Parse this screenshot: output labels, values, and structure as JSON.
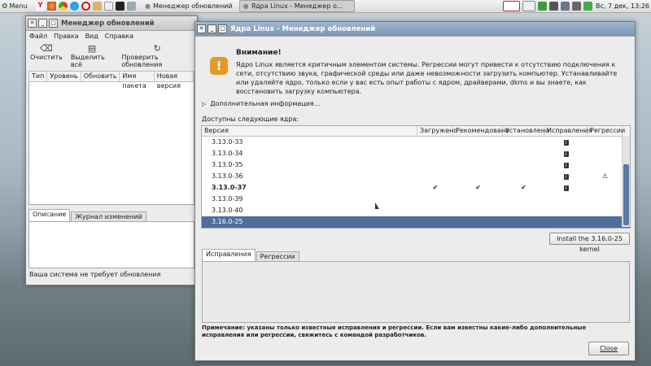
{
  "panel": {
    "menu_label": "Menu",
    "taskbar": [
      {
        "label": "Менеджер обновлений",
        "active": false
      },
      {
        "label": "Ядра Linux - Менеджер о...",
        "active": true
      }
    ],
    "clock": "Вс, 7 дек, 13:26"
  },
  "update_manager": {
    "title": "Менеджер обновлений",
    "menu": [
      "Файл",
      "Правка",
      "Вид",
      "Справка"
    ],
    "toolbar": [
      "Очистить",
      "Выделить всё",
      "Проверить обновления"
    ],
    "columns": [
      "Тип",
      "Уровень",
      "Обновить",
      "Имя пакета",
      "Новая версия"
    ],
    "tabs": [
      "Описание",
      "Журнал изменений"
    ],
    "status": "Ваша система не требует обновления"
  },
  "kernels": {
    "title": "Ядра Linux - Менеджер обновлений",
    "warning_heading": "Внимание!",
    "warning_text": "Ядро Linux является критичным элементом системы. Регрессии могут привести к отсутствию подключения к сети, отсутствию звука, графической среды или даже невозможности загрузить компьютер. Устанавливайте или удаляйте ядро, только если у вас есть опыт работы с ядром, драйверами, dkms и вы знаете, как восстановить загрузку компьютера.",
    "more_info": "Дополнительная информация...",
    "available_label": "Доступны следующие ядра:",
    "columns": [
      "Версия",
      "Загружено",
      "Рекомендовано",
      "Установлено",
      "Исправления",
      "Регрессии"
    ],
    "rows": [
      {
        "version": "3.13.0-33",
        "loaded": "",
        "recommended": "",
        "installed": "",
        "fixes": true,
        "regress": false,
        "bold": false,
        "selected": false
      },
      {
        "version": "3.13.0-34",
        "loaded": "",
        "recommended": "",
        "installed": "",
        "fixes": true,
        "regress": false,
        "bold": false,
        "selected": false
      },
      {
        "version": "3.13.0-35",
        "loaded": "",
        "recommended": "",
        "installed": "",
        "fixes": true,
        "regress": false,
        "bold": false,
        "selected": false
      },
      {
        "version": "3.13.0-36",
        "loaded": "",
        "recommended": "",
        "installed": "",
        "fixes": true,
        "regress": true,
        "bold": false,
        "selected": false
      },
      {
        "version": "3.13.0-37",
        "loaded": "✔",
        "recommended": "✔",
        "installed": "✔",
        "fixes": true,
        "regress": false,
        "bold": true,
        "selected": false
      },
      {
        "version": "3.13.0-39",
        "loaded": "",
        "recommended": "",
        "installed": "",
        "fixes": false,
        "regress": false,
        "bold": false,
        "selected": false
      },
      {
        "version": "3.13.0-40",
        "loaded": "",
        "recommended": "",
        "installed": "",
        "fixes": false,
        "regress": false,
        "bold": false,
        "selected": false
      },
      {
        "version": "3.16.0-25",
        "loaded": "",
        "recommended": "",
        "installed": "",
        "fixes": false,
        "regress": false,
        "bold": false,
        "selected": true
      }
    ],
    "install_button": "Install the 3.16.0-25 kernel",
    "detail_tabs": [
      "Исправления",
      "Регрессии"
    ],
    "note": "Примечание: указаны только известные исправления и регрессии. Если вам известны какие-либо дополнительные исправления или регрессии, свяжитесь с командой разработчиков.",
    "close_button": "Close"
  }
}
